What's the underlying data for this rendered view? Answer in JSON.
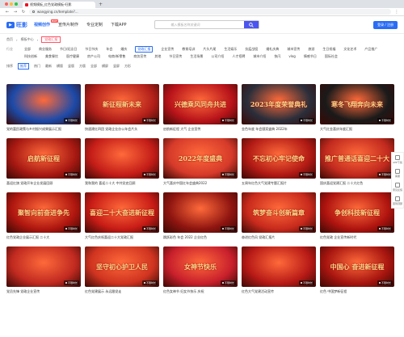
{
  "browser": {
    "tab_title": "视频模板_红色党政模板-旺影",
    "url": "wangying.cn/template?..."
  },
  "site": {
    "logo": "旺影",
    "nav": [
      "视频创作",
      "宣传片制作",
      "专业定制",
      "下载APP"
    ],
    "nav_badge": "HOT",
    "search_placeholder": "输入模板名称关键词",
    "login": "登录 / 注册"
  },
  "breadcrumb": [
    "首页",
    "模板中心",
    "党政汇报"
  ],
  "filters": {
    "row1": {
      "label": "行业",
      "items": [
        "全部",
        "商业服务",
        "节日/纪念日",
        "节日节庆",
        "年会",
        "婚庆",
        "党政汇报",
        "企业宣传",
        "教育培训",
        "片头片尾",
        "生活娱乐",
        "抗疫战役",
        "婚礼庆典",
        "城市宣传",
        "旅游",
        "生日祝福",
        "文化艺术",
        "产品推广"
      ],
      "selected": "党政汇报"
    },
    "row2": {
      "label": "",
      "items": [
        "科技创新",
        "美食餐饮",
        "医疗健康",
        "房产公司",
        "电商/新零售",
        "商务宣传",
        "其他",
        "节日宣传",
        "生活场景",
        "公司介绍",
        "人才招聘",
        "城市介绍",
        "快闪",
        "vlog",
        "情感节日",
        "国际社会"
      ]
    },
    "sort": {
      "label": "排序",
      "items": [
        "推荐",
        "热门",
        "最新",
        "横版",
        "竖版",
        "方版",
        "全部",
        "横屏",
        "竖屏",
        "方形"
      ],
      "selected": "推荐"
    }
  },
  "cards": [
    {
      "title": "党的富民政策与乡村振兴成果展示汇报",
      "text": "",
      "bg": "#1c4aa8"
    },
    {
      "title": "快速建红四团 党政企业办公年会片头",
      "text": "新征程新未来",
      "bg": "#b3201a"
    },
    {
      "title": "启航新征程 大气 企业宣传",
      "text": "兴德乘风同舟共进",
      "bg": "#b8141a"
    },
    {
      "title": "金色年度 年会颁奖盛典 2022年",
      "text": "2023年度荣誉典礼",
      "bg": "#2a2e3a"
    },
    {
      "title": "大气红金喜庆年度汇报",
      "text": "寒冬飞翔奔向未来",
      "bg": "#1a1a1a"
    },
    {
      "title": "喜迎红旗 党政开年企业发展回顾",
      "text": "启航新征程",
      "bg": "#a81912"
    },
    {
      "title": "我和我的 喜迎二十大 中共党史回顾",
      "text": "",
      "bg": "#c41d18"
    },
    {
      "title": "大气喜庆中国红年会盛典2022",
      "text": "2022年度盛典",
      "bg": "#d63a2a"
    },
    {
      "title": "五周年红色大气党建专题汇报片",
      "text": "不忘初心牢记使命",
      "bg": "#b11a14"
    },
    {
      "title": "国庆喜迎党建汇报 二十大红色",
      "text": "推广普通话喜迎二十大",
      "bg": "#c22a1e"
    },
    {
      "title": "红色党政企业展示汇报 二十大",
      "text": "聚智向前奋进争先",
      "bg": "#b0170f"
    },
    {
      "title": "大气红色庆祝喜迎二十大党政汇报",
      "text": "喜迎二十大奋进新征程",
      "bg": "#c81c16"
    },
    {
      "title": "跳跃彩色 年会 2022 企业红色",
      "text": "",
      "bg": "#8f1510"
    },
    {
      "title": "奋进红色风 党政汇报片",
      "text": "筑梦奋斗创新篇章",
      "bg": "#c82a1c"
    },
    {
      "title": "红色党政 企业宣传新时代",
      "text": "争创科技新征程",
      "bg": "#b0140f"
    },
    {
      "title": "党员先锋 党政企业宣传",
      "text": "",
      "bg": "#c12a20"
    },
    {
      "title": "红色党建展示 永远跟党走",
      "text": "坚守初心护卫人民",
      "bg": "#d03420"
    },
    {
      "title": "红色女神节 妇女节快乐 庆祝",
      "text": "女神节快乐",
      "bg": "#c9202c"
    },
    {
      "title": "红色大气党建活动宣传",
      "text": "",
      "bg": "#b81a16"
    },
    {
      "title": "红色 中国梦新征程",
      "text": "中国心 奋进新征程",
      "bg": "#a7150f"
    }
  ],
  "card_chip": "不限时长",
  "sidebar": [
    "APP下载",
    "客服",
    "意见反馈",
    "回到顶部"
  ],
  "colors": {
    "accent": "#2a6df4",
    "brand_red": "#c41d18"
  }
}
